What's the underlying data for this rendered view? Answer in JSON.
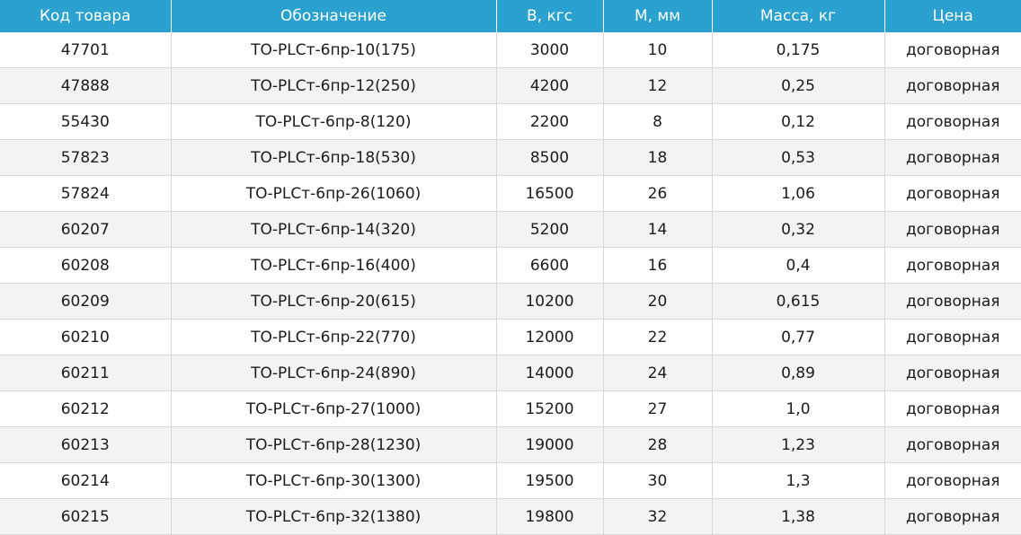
{
  "table": {
    "headers": [
      "Код товара",
      "Обозначение",
      "B, кгс",
      "M, мм",
      "Масса, кг",
      "Цена"
    ],
    "rows": [
      [
        "47701",
        "ТО-PLCт-6пр-10(175)",
        "3000",
        "10",
        "0,175",
        "договорная"
      ],
      [
        "47888",
        "ТО-PLCт-6пр-12(250)",
        "4200",
        "12",
        "0,25",
        "договорная"
      ],
      [
        "55430",
        "ТО-PLCт-6пр-8(120)",
        "2200",
        "8",
        "0,12",
        "договорная"
      ],
      [
        "57823",
        "ТО-PLCт-6пр-18(530)",
        "8500",
        "18",
        "0,53",
        "договорная"
      ],
      [
        "57824",
        "ТО-PLCт-6пр-26(1060)",
        "16500",
        "26",
        "1,06",
        "договорная"
      ],
      [
        "60207",
        "ТО-PLCт-6пр-14(320)",
        "5200",
        "14",
        "0,32",
        "договорная"
      ],
      [
        "60208",
        "ТО-PLCт-6пр-16(400)",
        "6600",
        "16",
        "0,4",
        "договорная"
      ],
      [
        "60209",
        "ТО-PLCт-6пр-20(615)",
        "10200",
        "20",
        "0,615",
        "договорная"
      ],
      [
        "60210",
        "ТО-PLCт-6пр-22(770)",
        "12000",
        "22",
        "0,77",
        "договорная"
      ],
      [
        "60211",
        "ТО-PLCт-6пр-24(890)",
        "14000",
        "24",
        "0,89",
        "договорная"
      ],
      [
        "60212",
        "ТО-PLCт-6пр-27(1000)",
        "15200",
        "27",
        "1,0",
        "договорная"
      ],
      [
        "60213",
        "ТО-PLCт-6пр-28(1230)",
        "19000",
        "28",
        "1,23",
        "договорная"
      ],
      [
        "60214",
        "ТО-PLCт-6пр-30(1300)",
        "19500",
        "30",
        "1,3",
        "договорная"
      ],
      [
        "60215",
        "ТО-PLCт-6пр-32(1380)",
        "19800",
        "32",
        "1,38",
        "договорная"
      ]
    ]
  },
  "colors": {
    "header_bg": "#2aa1cf",
    "header_text": "#ffffff",
    "row_alt_bg": "#f3f3f3",
    "grid_line": "#d8d8d8"
  }
}
